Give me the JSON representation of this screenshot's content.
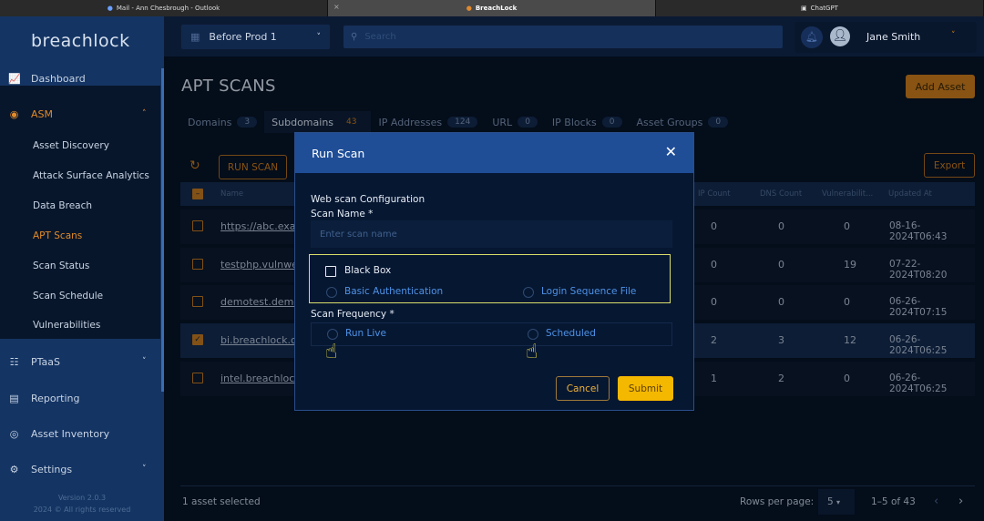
{
  "browser_tabs": [
    {
      "label": "Mail - Ann Chesbrough - Outlook",
      "icon": "outlook-icon"
    },
    {
      "label": "BreachLock",
      "icon": "breachlock-icon",
      "active": true
    },
    {
      "label": "ChatGPT",
      "icon": "chatgpt-icon"
    }
  ],
  "logo": "breachlock",
  "sidebar": {
    "items": [
      {
        "label": "Dashboard",
        "icon": "chart-icon"
      },
      {
        "label": "ASM",
        "icon": "target-icon",
        "active": true
      },
      {
        "label": "PTaaS",
        "icon": "ptaas-icon"
      },
      {
        "label": "Reporting",
        "icon": "report-icon"
      },
      {
        "label": "Asset Inventory",
        "icon": "inventory-icon"
      },
      {
        "label": "Settings",
        "icon": "gear-icon"
      }
    ],
    "asm_sub": [
      "Asset Discovery",
      "Attack Surface Analytics",
      "Data Breach",
      "APT Scans",
      "Scan Status",
      "Scan Schedule",
      "Vulnerabilities"
    ],
    "version": "Version 2.0.3",
    "copyright": "2024 © All rights reserved"
  },
  "header": {
    "org": "Before Prod 1",
    "search_placeholder": "Search",
    "user": "Jane Smith"
  },
  "page": {
    "title": "APT SCANS",
    "add_asset": "Add Asset",
    "run_scan": "RUN SCAN",
    "export": "Export"
  },
  "tabs": [
    {
      "label": "Domains",
      "count": "3"
    },
    {
      "label": "Subdomains",
      "count": "43",
      "active": true
    },
    {
      "label": "IP Addresses",
      "count": "124"
    },
    {
      "label": "URL",
      "count": "0"
    },
    {
      "label": "IP Blocks",
      "count": "0"
    },
    {
      "label": "Asset Groups",
      "count": "0"
    }
  ],
  "table": {
    "columns": [
      "Name",
      "IP Count",
      "DNS Count",
      "Vulnerabilit...",
      "Updated At"
    ],
    "rows": [
      {
        "name": "https://abc.exar",
        "ip": "0",
        "dns": "0",
        "vuln": "0",
        "updated": "08-16-2024T06:43",
        "checked": false
      },
      {
        "name": "testphp.vulnwel",
        "ip": "0",
        "dns": "0",
        "vuln": "19",
        "updated": "07-22-2024T08:20",
        "checked": false
      },
      {
        "name": "demotest.demo",
        "ip": "0",
        "dns": "0",
        "vuln": "0",
        "updated": "06-26-2024T07:15",
        "checked": false
      },
      {
        "name": "bi.breachlock.co",
        "ip": "2",
        "dns": "3",
        "vuln": "12",
        "updated": "06-26-2024T06:25",
        "checked": true
      },
      {
        "name": "intel.breachlock",
        "ip": "1",
        "dns": "2",
        "vuln": "0",
        "updated": "06-26-2024T06:25",
        "checked": false
      }
    ]
  },
  "footer": {
    "selected": "1 asset selected",
    "rows_per_page_label": "Rows per page:",
    "rows_per_page": "5",
    "range": "1–5 of 43"
  },
  "modal": {
    "title": "Run Scan",
    "section": "Web scan Configuration",
    "scan_name_label": "Scan Name *",
    "scan_name_placeholder": "Enter scan name",
    "black_box": "Black Box",
    "basic_auth": "Basic Authentication",
    "login_seq": "Login Sequence File",
    "freq_label": "Scan Frequency *",
    "run_live": "Run Live",
    "scheduled": "Scheduled",
    "cancel": "Cancel",
    "submit": "Submit"
  },
  "colors": {
    "accent": "#d07b14",
    "sidebar": "#143463",
    "modal_header": "#1f4e97",
    "submit": "#f5b800"
  }
}
